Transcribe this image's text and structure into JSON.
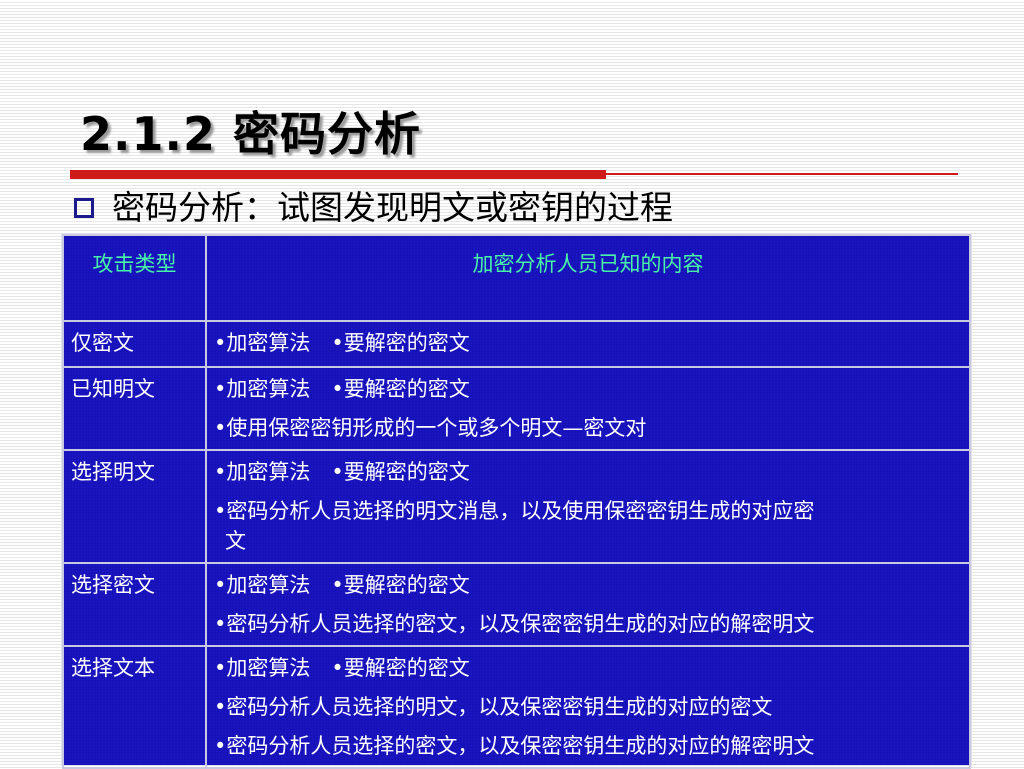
{
  "slide": {
    "title": "2.1.2 密码分析",
    "bullet": "密码分析：试图发现明文或密钥的过程"
  },
  "table": {
    "headers": [
      "攻击类型",
      "加密分析人员已知的内容"
    ],
    "rows": [
      {
        "type": "仅密文",
        "known": [
          "•加密算法　•要解密的密文"
        ]
      },
      {
        "type": "已知明文",
        "known": [
          "•加密算法　•要解密的密文",
          "•使用保密密钥形成的一个或多个明文—密文对"
        ]
      },
      {
        "type": "选择明文",
        "known": [
          "•加密算法　•要解密的密文",
          "•密码分析人员选择的明文消息，以及使用保密密钥生成的对应密",
          "文"
        ]
      },
      {
        "type": "选择密文",
        "known": [
          "•加密算法　•要解密的密文",
          "•密码分析人员选择的密文，以及保密密钥生成的对应的解密明文"
        ]
      },
      {
        "type": "选择文本",
        "known": [
          "•加密算法　•要解密的密文",
          "•密码分析人员选择的明文，以及保密密钥生成的对应的密文",
          "•密码分析人员选择的密文，以及保密密钥生成的对应的解密明文"
        ]
      }
    ]
  },
  "colors": {
    "table_bg": "#1510b4",
    "header_text": "#49f2a9",
    "title_bar": "#d01a1a",
    "bullet_box": "#1a1a8c"
  }
}
